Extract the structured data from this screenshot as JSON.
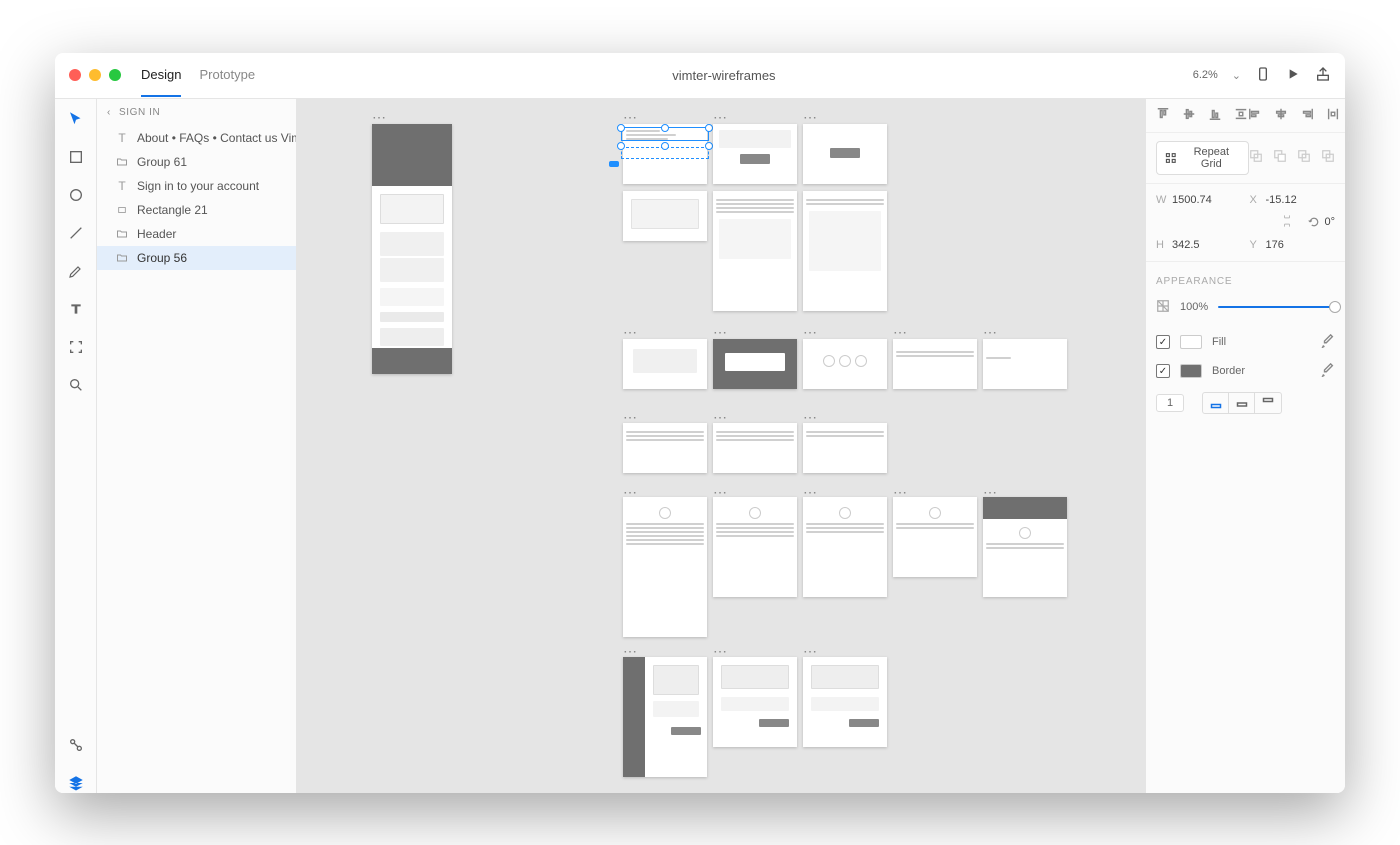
{
  "titlebar": {
    "tabs": {
      "design": "Design",
      "prototype": "Prototype"
    },
    "document": "vimter-wireframes",
    "zoom": "6.2%"
  },
  "layers": {
    "breadcrumb": "SIGN IN",
    "items": [
      {
        "icon": "text",
        "label": "About • FAQs • Contact us  Vimt..."
      },
      {
        "icon": "folder",
        "label": "Group 61"
      },
      {
        "icon": "text",
        "label": "Sign in to your account"
      },
      {
        "icon": "rect",
        "label": "Rectangle 21"
      },
      {
        "icon": "folder",
        "label": "Header"
      },
      {
        "icon": "folder",
        "label": "Group 56",
        "selected": true
      }
    ]
  },
  "inspector": {
    "repeat_grid": "Repeat Grid",
    "w": "1500.74",
    "h": "342.5",
    "x": "-15.12",
    "y": "176",
    "rotation": "0°",
    "appearance_title": "APPEARANCE",
    "opacity": "100%",
    "fill_label": "Fill",
    "border_label": "Border",
    "stroke_width": "1"
  }
}
